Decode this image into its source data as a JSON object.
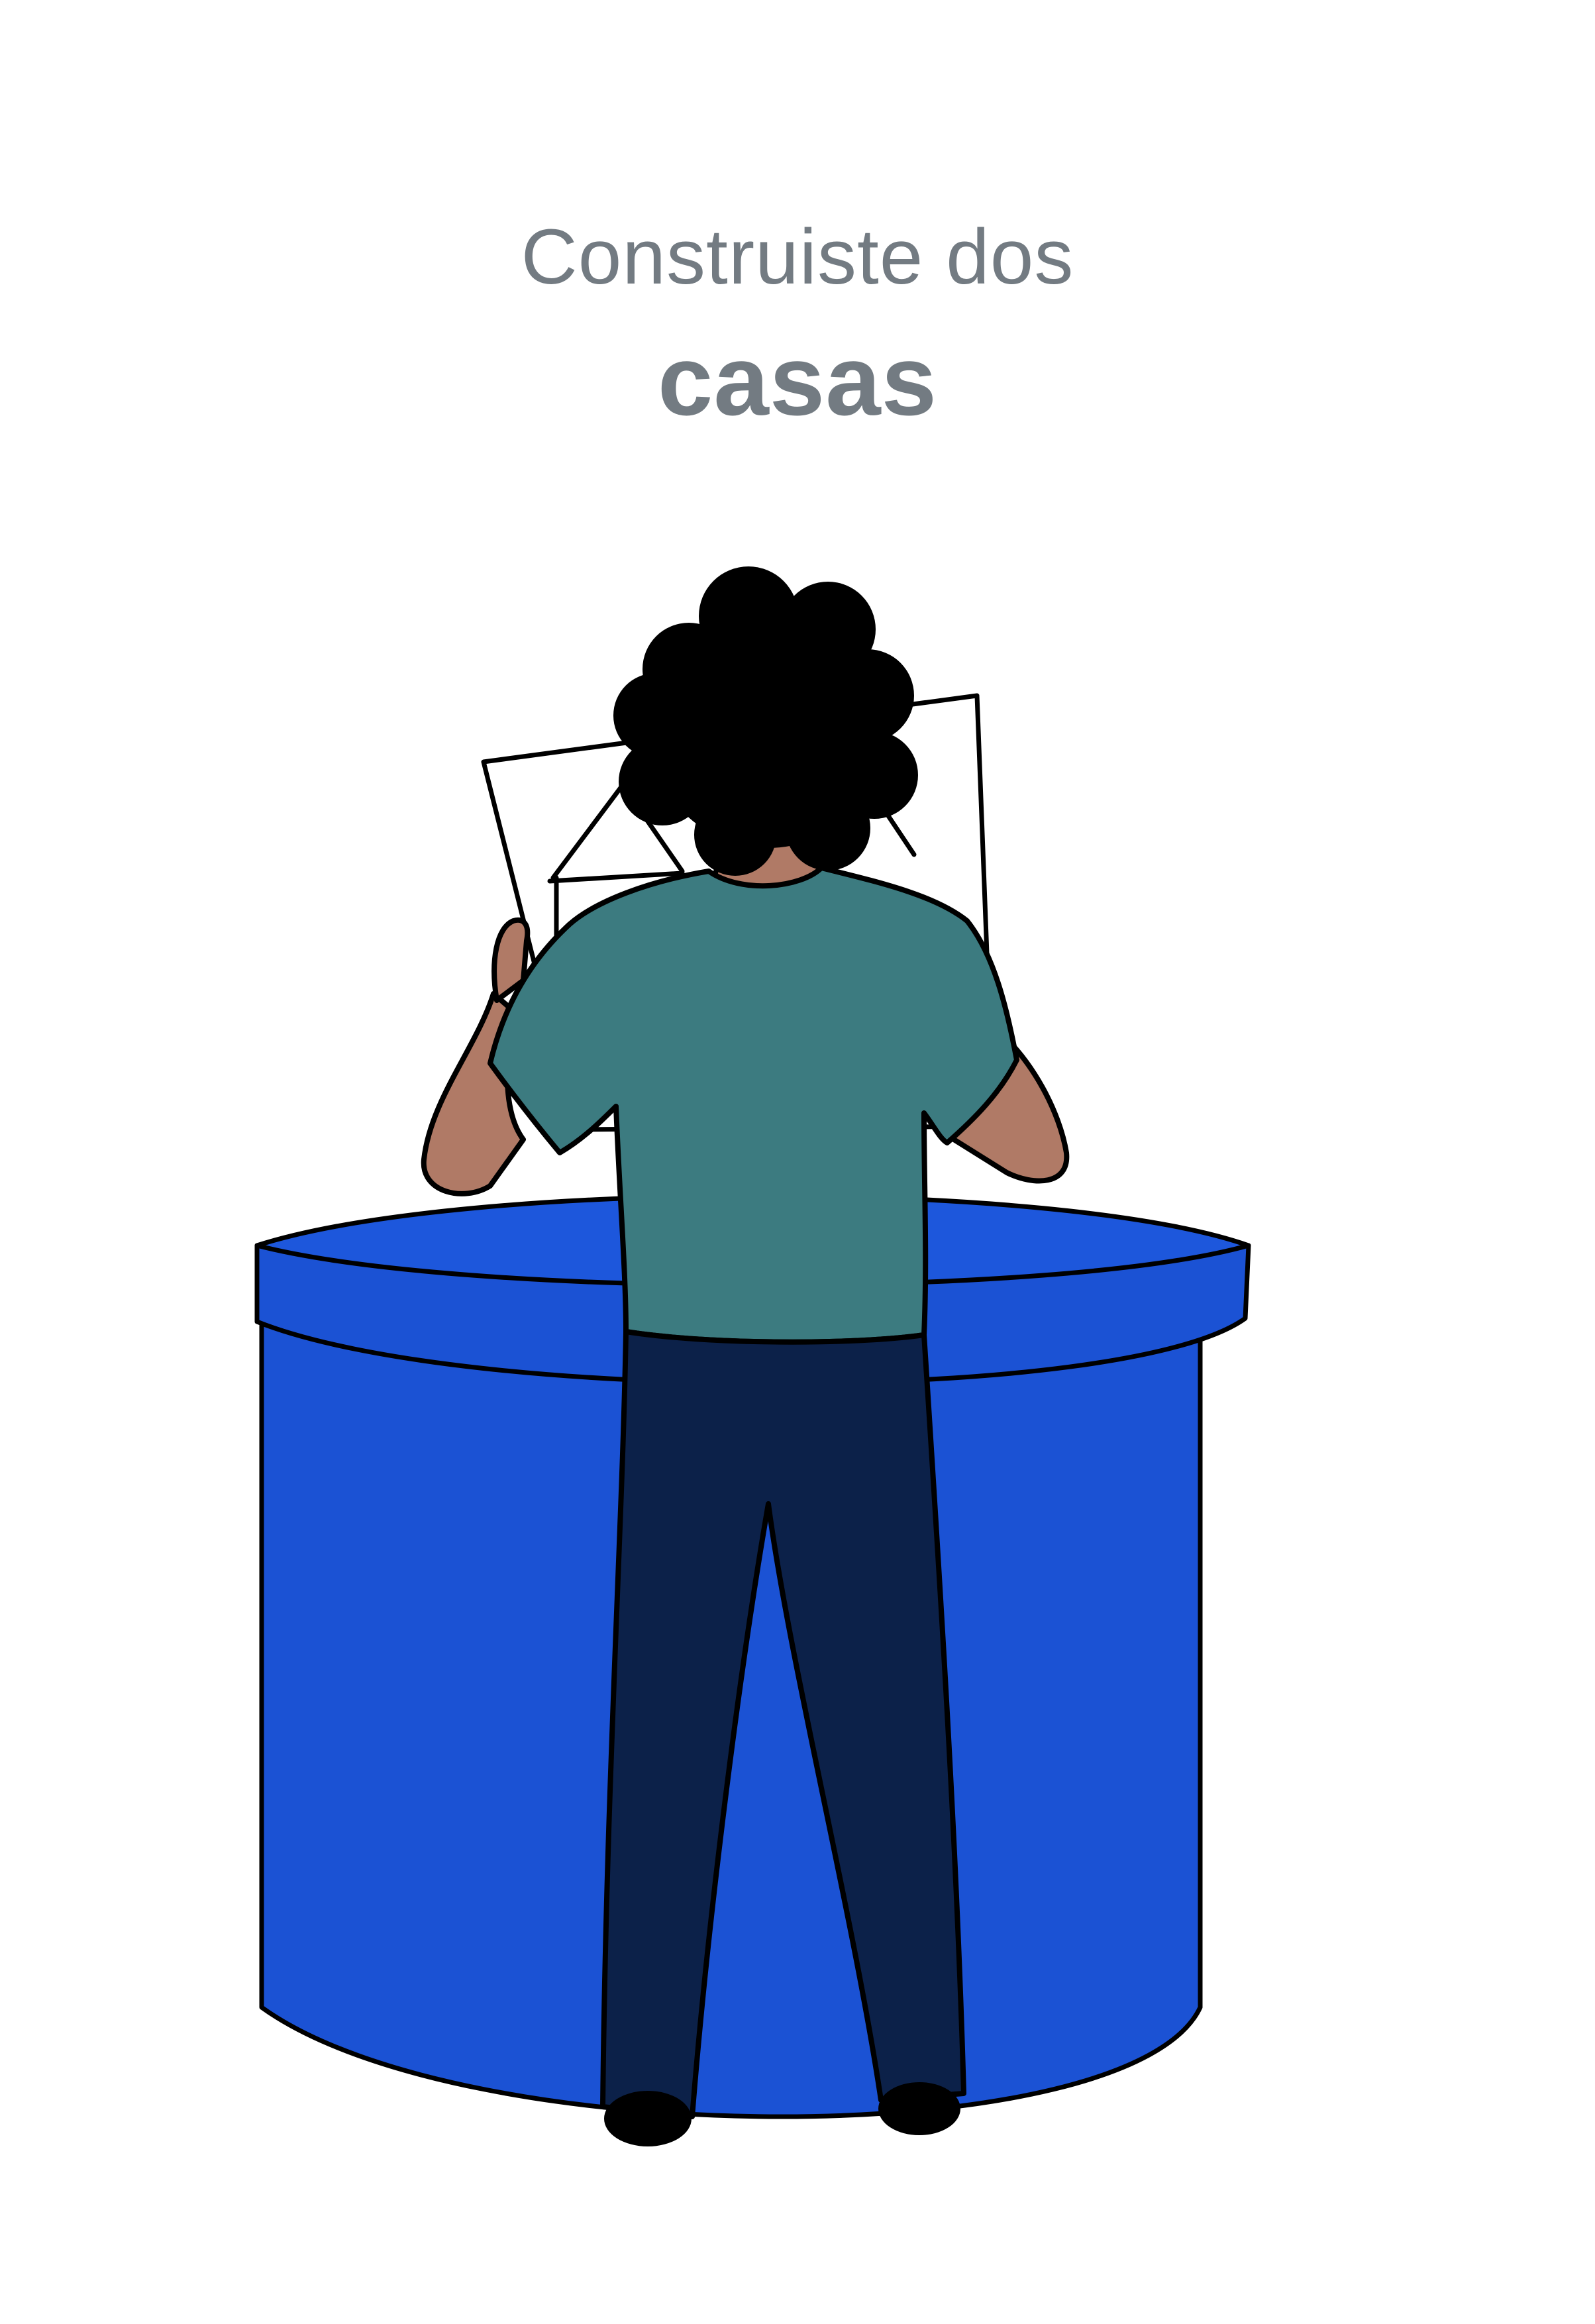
{
  "caption": {
    "line1": "Construiste dos",
    "line2": "casas"
  },
  "illustration": {
    "subject": "person-holding-house-drawing",
    "colors": {
      "caption_text": "#737b82",
      "cylinder_blue": "#1b52d4",
      "shirt_teal": "#3c7b80",
      "pants_navy": "#0c2149",
      "hair": "#000000",
      "skin": "#b07a66",
      "outline": "#000000"
    }
  }
}
